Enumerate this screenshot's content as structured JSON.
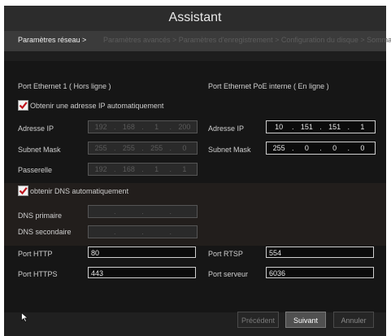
{
  "window": {
    "title": "Assistant"
  },
  "breadcrumb": {
    "current": "Paramètres réseau >",
    "rest": "Paramètres avancés > Paramètres d'enregistrement > Configuration du disque > Sommaire"
  },
  "ethernet1": {
    "header": "Port Ethernet 1 ( Hors ligne )",
    "auto_ip_label": "Obtenir une adresse IP automatiquement",
    "ip_label": "Adresse IP",
    "ip": [
      "192",
      "168",
      "1",
      "200"
    ],
    "mask_label": "Subnet Mask",
    "mask": [
      "255",
      "255",
      "255",
      "0"
    ],
    "gateway_label": "Passerelle",
    "gateway": [
      "192",
      "168",
      "1",
      "1"
    ]
  },
  "poe": {
    "header": "Port Ethernet PoE interne ( En ligne )",
    "ip_label": "Adresse IP",
    "ip": [
      "10",
      "151",
      "151",
      "1"
    ],
    "mask_label": "Subnet Mask",
    "mask": [
      "255",
      "0",
      "0",
      "0"
    ]
  },
  "dns": {
    "auto_label": "obtenir DNS automatiquement",
    "primary_label": "DNS primaire",
    "secondary_label": "DNS secondaire"
  },
  "ports": {
    "http_label": "Port HTTP",
    "http": "80",
    "https_label": "Port HTTPS",
    "https": "443",
    "rtsp_label": "Port RTSP",
    "rtsp": "554",
    "server_label": "Port serveur",
    "server": "6036"
  },
  "buttons": {
    "previous": "Précédent",
    "next": "Suivant",
    "cancel": "Annuler"
  },
  "colors": {
    "check": "#c0141c",
    "selected_button": "#7a7a7a",
    "background": "#161616"
  }
}
